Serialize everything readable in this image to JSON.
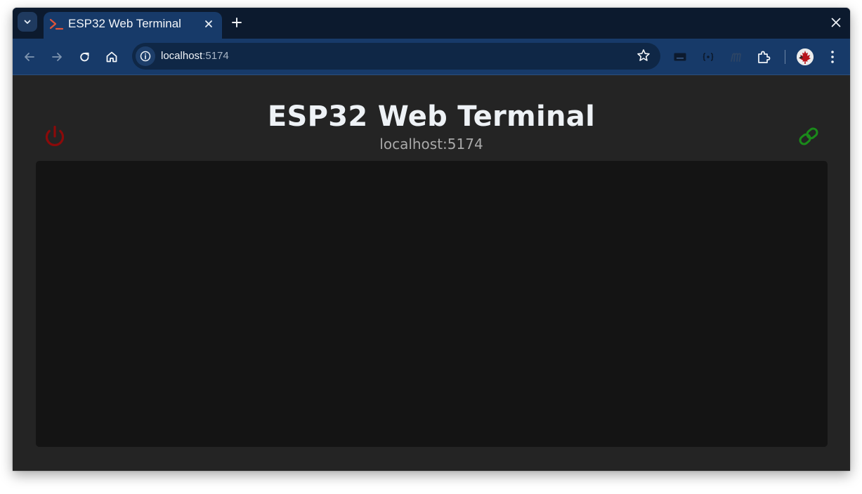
{
  "browser": {
    "tab": {
      "title": "ESP32 Web Terminal"
    },
    "address_bar": {
      "host": "localhost",
      "port": ":5174"
    }
  },
  "page": {
    "title": "ESP32 Web Terminal",
    "subtitle": "localhost:5174",
    "power_icon_color": "#8b0a0a",
    "link_icon_color": "#1a8a1a",
    "terminal_background": "#141414",
    "icons": [
      "power-icon",
      "link-icon"
    ]
  }
}
